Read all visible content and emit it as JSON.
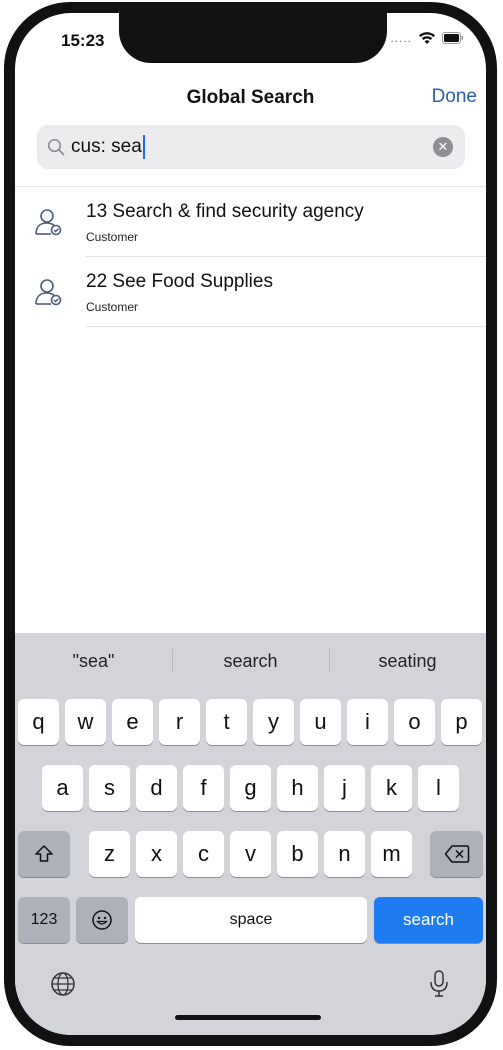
{
  "status_bar": {
    "time": "15:23",
    "signal": "....."
  },
  "header": {
    "title": "Global Search",
    "done_label": "Done"
  },
  "search": {
    "query": "cus: sea",
    "clear_glyph": "✕"
  },
  "results": [
    {
      "title": "13 Search & find security agency",
      "subtitle": "Customer",
      "icon": "customer-icon"
    },
    {
      "title": "22 See Food Supplies",
      "subtitle": "Customer",
      "icon": "customer-icon"
    }
  ],
  "keyboard": {
    "suggestions": [
      "\"sea\"",
      "search",
      "seating"
    ],
    "row1": [
      "q",
      "w",
      "e",
      "r",
      "t",
      "y",
      "u",
      "i",
      "o",
      "p"
    ],
    "row2": [
      "a",
      "s",
      "d",
      "f",
      "g",
      "h",
      "j",
      "k",
      "l"
    ],
    "row3": [
      "z",
      "x",
      "c",
      "v",
      "b",
      "n",
      "m"
    ],
    "numbers_label": "123",
    "space_label": "space",
    "search_label": "search",
    "accent_color": "#1d7cf2"
  }
}
